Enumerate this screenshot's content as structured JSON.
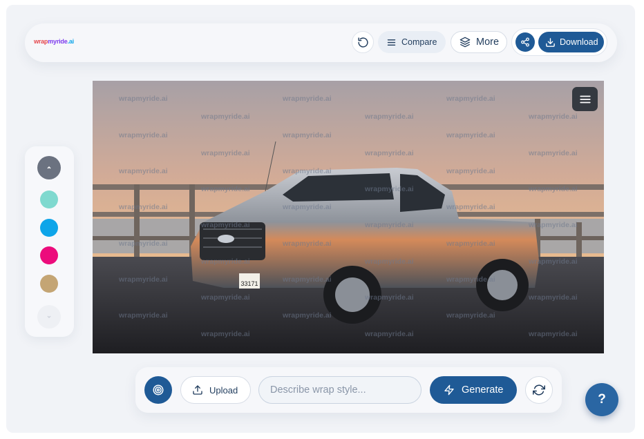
{
  "app": {
    "logo": {
      "part1": "wrap",
      "part2": "myride",
      "part3": ".ai"
    }
  },
  "toolbar": {
    "undo_icon": "undo-icon",
    "compare_label": "Compare",
    "more_label": "More",
    "share_icon": "share-icon",
    "download_label": "Download"
  },
  "image": {
    "subject": "Ford F-150 pickup truck",
    "watermark_text": "wrapmyride.ai",
    "menu_icon": "hamburger-icon",
    "plate_line1": "33171"
  },
  "palette": {
    "colors": [
      {
        "name": "teal",
        "hex": "#7fd9cf"
      },
      {
        "name": "blue",
        "hex": "#0ea5e9"
      },
      {
        "name": "magenta",
        "hex": "#ec0c7c"
      },
      {
        "name": "tan",
        "hex": "#c4a574"
      }
    ]
  },
  "prompt": {
    "upload_label": "Upload",
    "input_placeholder": "Describe wrap style...",
    "input_value": "",
    "generate_label": "Generate"
  },
  "help": {
    "label": "?"
  }
}
